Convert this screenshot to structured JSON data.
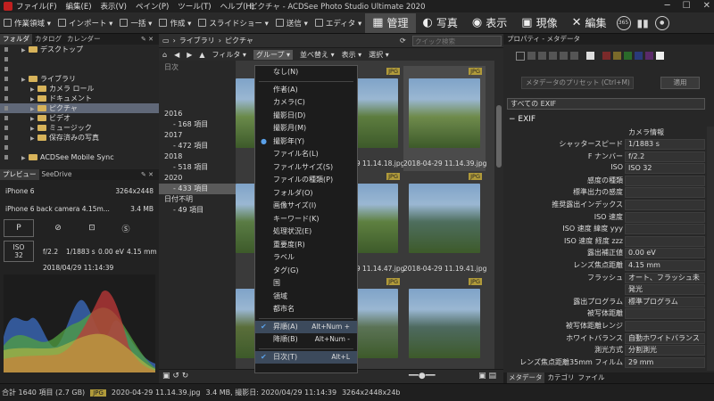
{
  "menubar": {
    "items": [
      "ファイル(F)",
      "編集(E)",
      "表示(V)",
      "ペイン(P)",
      "ツール(T)",
      "ヘルプ(H)"
    ],
    "window_title": "ピクチャ - ACDSee Photo Studio Ultimate 2020"
  },
  "toolbar": {
    "items": [
      "作業領域 ▾",
      "インポート ▾",
      "一括 ▾",
      "作成 ▾",
      "スライドショー ▾",
      "送信 ▾",
      "エディタ ▾"
    ],
    "modes": [
      {
        "label": "管理",
        "icon": "grid-icon"
      },
      {
        "label": "写真",
        "icon": "photos-icon"
      },
      {
        "label": "表示",
        "icon": "eye-icon"
      },
      {
        "label": "現像",
        "icon": "develop-icon"
      },
      {
        "label": "編集",
        "icon": "edit-icon"
      }
    ],
    "extra": [
      "365"
    ]
  },
  "left_panel": {
    "tabs": [
      "フォルダ",
      "カタログ",
      "カレンダー"
    ],
    "tree": [
      {
        "label": "デスクトップ",
        "indent": 1
      },
      {
        "label": "",
        "indent": 0
      },
      {
        "label": "",
        "indent": 0
      },
      {
        "label": "ライブラリ",
        "indent": 1
      },
      {
        "label": "カメラ ロール",
        "indent": 2
      },
      {
        "label": "ドキュメント",
        "indent": 2
      },
      {
        "label": "ピクチャ",
        "indent": 2,
        "selected": true
      },
      {
        "label": "ビデオ",
        "indent": 2
      },
      {
        "label": "ミュージック",
        "indent": 2
      },
      {
        "label": "保存済みの写真",
        "indent": 2
      },
      {
        "label": "",
        "indent": 0
      },
      {
        "label": "ACDSee Mobile Sync",
        "indent": 1
      }
    ],
    "preview_tabs": [
      "プレビュー",
      "SeeDrive"
    ],
    "camera": "iPhone 6",
    "dimensions": "3264x2448",
    "lens": "iPhone 6 back camera 4.15m...",
    "size": "3.4 MB",
    "mode": "P",
    "iso_label": "ISO",
    "iso": "32",
    "aperture": "f/2.2",
    "shutter": "1/1883 s",
    "ev": "0.00 eV",
    "focal": "4.15 mm",
    "date": "2018/04/29 11:14:39"
  },
  "center": {
    "breadcrumb": [
      "ライブラリ",
      "ピクチャ"
    ],
    "search_placeholder": "クイック検索",
    "subtoolbar": [
      "フィルタ ▾",
      "グループ ▾",
      "並べ替え ▾",
      "表示 ▾",
      "選択 ▾"
    ],
    "date_header": "日次",
    "years": [
      {
        "label": "2016",
        "sub": false
      },
      {
        "label": "- 168 項目",
        "sub": true
      },
      {
        "label": "2017",
        "sub": false
      },
      {
        "label": "- 472 項目",
        "sub": true
      },
      {
        "label": "2018",
        "sub": false
      },
      {
        "label": "- 518 項目",
        "sub": true
      },
      {
        "label": "2020",
        "sub": false
      },
      {
        "label": "- 433 項目",
        "sub": true,
        "selected": true
      },
      {
        "label": "日付不明",
        "sub": false
      },
      {
        "label": "- 49 項目",
        "sub": true
      }
    ],
    "thumbs": [
      {
        "name": "2018...",
        "badge": "JPG",
        "col": 0,
        "row": 0,
        "tone": "#6a8a4a"
      },
      {
        "name": "2018-04-29 11.14.18.jpg",
        "badge": "JPG",
        "col": 1,
        "row": 0,
        "tone": "#5d7d3f"
      },
      {
        "name": "2018-04-29 11.14.39.jpg",
        "badge": "JPG",
        "col": 2,
        "row": 0,
        "tone": "#6f8b4c",
        "selected": true
      },
      {
        "name": "2018...",
        "badge": "JPG",
        "col": 0,
        "row": 1,
        "tone": "#5a7c44"
      },
      {
        "name": "2018-04-29 11.14.47.jpg",
        "badge": "JPG",
        "col": 1,
        "row": 1,
        "tone": "#5e8040"
      },
      {
        "name": "2018-04-29 11.19.41.jpg",
        "badge": "JPG",
        "col": 2,
        "row": 1,
        "tone": "#4e6e5e"
      },
      {
        "name": "2018...",
        "badge": "JPG",
        "col": 0,
        "row": 2,
        "tone": "#5a6e3a"
      },
      {
        "name": "2018-04-29 11.19.53.jpg",
        "badge": "JPG",
        "col": 1,
        "row": 2,
        "tone": "#5b7356"
      },
      {
        "name": "2018-04-29 11.19.59.jpg",
        "badge": "JPG",
        "col": 2,
        "row": 2,
        "tone": "#4e6a60"
      }
    ],
    "group_menu": [
      {
        "label": "なし(N)"
      },
      {
        "sep": true
      },
      {
        "label": "作者(A)"
      },
      {
        "label": "カメラ(C)"
      },
      {
        "label": "撮影日(D)"
      },
      {
        "label": "撮影月(M)"
      },
      {
        "label": "撮影年(Y)",
        "bullet": true
      },
      {
        "label": "ファイル名(L)"
      },
      {
        "label": "ファイルサイズ(S)"
      },
      {
        "label": "ファイルの種類(P)"
      },
      {
        "label": "フォルダ(O)"
      },
      {
        "label": "画像サイズ(I)"
      },
      {
        "label": "キーワード(K)"
      },
      {
        "label": "処理状況(E)"
      },
      {
        "label": "重要度(R)"
      },
      {
        "label": "ラベル"
      },
      {
        "label": "タグ(G)"
      },
      {
        "label": "国"
      },
      {
        "label": "領域"
      },
      {
        "label": "都市名"
      },
      {
        "sep": true
      },
      {
        "label": "昇順(A)",
        "shortcut": "Alt+Num +",
        "check": true
      },
      {
        "label": "降順(B)",
        "shortcut": "Alt+Num -"
      },
      {
        "sep": true
      },
      {
        "label": "日次(T)",
        "shortcut": "Alt+L",
        "check": true
      }
    ]
  },
  "right_panel": {
    "title": "プロパティ - メタデータ",
    "preset_placeholder": "メタデータのプリセット (Ctrl+M)",
    "apply": "適用",
    "view": "すべての EXIF",
    "section": "EXIF",
    "camera_info": "カメラ情報",
    "props": [
      {
        "k": "シャッタースピード",
        "v": "1/1883 s"
      },
      {
        "k": "F ナンバー",
        "v": "f/2.2"
      },
      {
        "k": "ISO",
        "v": "ISO 32"
      },
      {
        "k": "感度の種類",
        "v": ""
      },
      {
        "k": "標準出力の感度",
        "v": ""
      },
      {
        "k": "推奨露出インデックス",
        "v": ""
      },
      {
        "k": "ISO 速度",
        "v": ""
      },
      {
        "k": "ISO 速度 緯度 yyy",
        "v": ""
      },
      {
        "k": "ISO 速度 経度 zzz",
        "v": ""
      },
      {
        "k": "露出補正値",
        "v": "0.00 eV"
      },
      {
        "k": "レンズ焦点距離",
        "v": "4.15 mm"
      },
      {
        "k": "フラッシュ",
        "v": "オート、フラッシュ未"
      },
      {
        "k": "",
        "v": "発光"
      },
      {
        "k": "露出プログラム",
        "v": "標準プログラム"
      },
      {
        "k": "被写体距離",
        "v": ""
      },
      {
        "k": "被写体距離レンジ",
        "v": ""
      },
      {
        "k": "ホワイトバランス",
        "v": "自動ホワイトバランス"
      },
      {
        "k": "測光方式",
        "v": "分割測光"
      },
      {
        "k": "レンズ焦点距離35mm フィルム",
        "v": "29 mm"
      }
    ],
    "bottom_tabs": [
      "メタデータ",
      "カテゴリ",
      "ファイル"
    ]
  },
  "statusbar": {
    "total": "合計 1640 項目 (2.7 GB)",
    "badge": "JPG",
    "file": "2020-04-29 11.14.39.jpg",
    "info": "3.4 MB, 撮影日: 2020/04/29 11:14:39",
    "dims": "3264x2448x24b"
  }
}
